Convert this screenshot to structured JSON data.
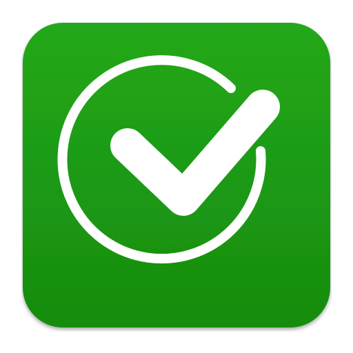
{
  "icon": {
    "semantic": "checkmark-icon",
    "colors": {
      "background": "#1c9c13",
      "background_top": "#24a81a",
      "background_bottom": "#168c0e",
      "shadow": "#000000",
      "mark": "#ffffff"
    }
  }
}
